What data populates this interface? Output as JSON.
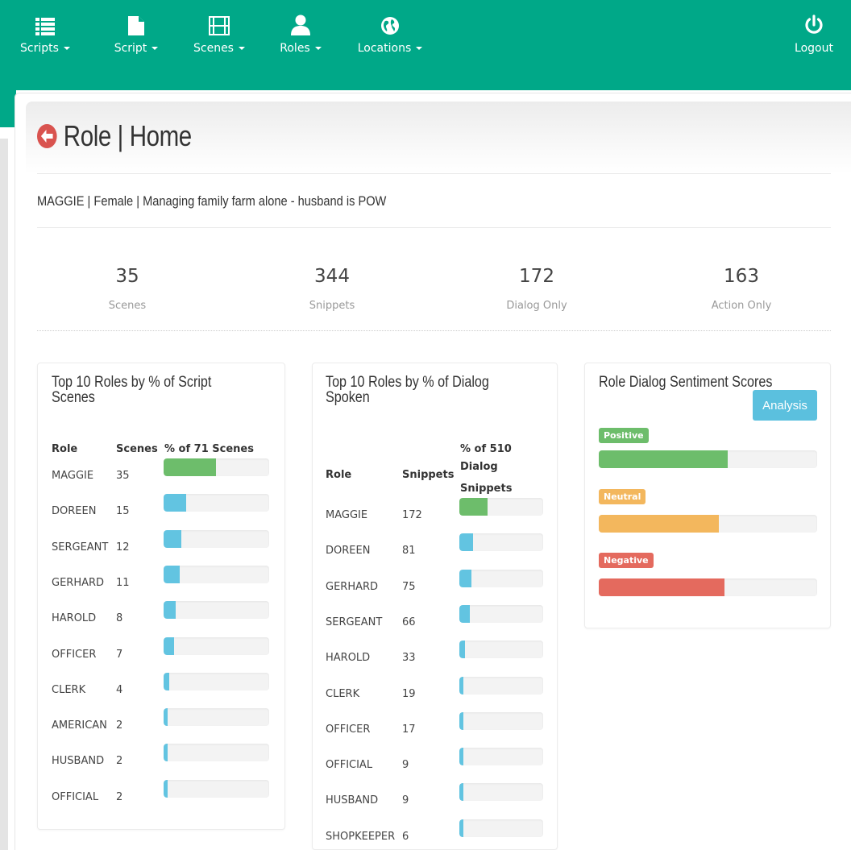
{
  "nav": {
    "items": [
      {
        "label": "Scripts",
        "icon": "list-icon"
      },
      {
        "label": "Script",
        "icon": "file-icon"
      },
      {
        "label": "Scenes",
        "icon": "film-icon"
      },
      {
        "label": "Roles",
        "icon": "user-icon"
      },
      {
        "label": "Locations",
        "icon": "globe-icon"
      }
    ],
    "logout": {
      "label": "Logout",
      "icon": "power-icon"
    }
  },
  "page": {
    "title": "Role | Home",
    "subtitle": "MAGGIE | Female | Managing family farm alone - husband is POW"
  },
  "stats": [
    {
      "value": "35",
      "label": "Scenes"
    },
    {
      "value": "344",
      "label": "Snippets"
    },
    {
      "value": "172",
      "label": "Dialog Only"
    },
    {
      "value": "163",
      "label": "Action Only"
    }
  ],
  "colors": {
    "accent": "#00a888",
    "green": "#6dbd6b",
    "blue": "#62c4e1",
    "orange": "#f3b75d",
    "red": "#e46a5e",
    "info_button": "#5bc0de"
  },
  "scenes_card": {
    "title_line1": "Top 10 Roles by % of Script",
    "title_line2": "Scenes",
    "header_role": "Role",
    "header_scenes": "Scenes",
    "header_pct": "% of 71 Scenes",
    "total": 71,
    "rows": [
      {
        "role": "MAGGIE",
        "count": "35",
        "value": 35
      },
      {
        "role": "DOREEN",
        "count": "15",
        "value": 15
      },
      {
        "role": "SERGEANT",
        "count": "12",
        "value": 12
      },
      {
        "role": "GERHARD",
        "count": "11",
        "value": 11
      },
      {
        "role": "HAROLD",
        "count": "8",
        "value": 8
      },
      {
        "role": "OFFICER",
        "count": "7",
        "value": 7
      },
      {
        "role": "CLERK",
        "count": "4",
        "value": 4
      },
      {
        "role": "AMERICAN",
        "count": "2",
        "value": 2
      },
      {
        "role": "HUSBAND",
        "count": "2",
        "value": 2
      },
      {
        "role": "OFFICIAL",
        "count": "2",
        "value": 2
      }
    ]
  },
  "dialog_card": {
    "title_line1": "Top 10 Roles by % of Dialog",
    "title_line2": "Spoken",
    "header_role": "Role",
    "header_snippets": "Snippets",
    "header_pct_line1": "% of 510",
    "header_pct_line2": "Dialog",
    "header_pct_line3": "Snippets",
    "total": 510,
    "rows": [
      {
        "role": "MAGGIE",
        "count": "172",
        "value": 172
      },
      {
        "role": "DOREEN",
        "count": "81",
        "value": 81
      },
      {
        "role": "GERHARD",
        "count": "75",
        "value": 75
      },
      {
        "role": "SERGEANT",
        "count": "66",
        "value": 66
      },
      {
        "role": "HAROLD",
        "count": "33",
        "value": 33
      },
      {
        "role": "CLERK",
        "count": "19",
        "value": 19
      },
      {
        "role": "OFFICER",
        "count": "17",
        "value": 17
      },
      {
        "role": "OFFICIAL",
        "count": "9",
        "value": 9
      },
      {
        "role": "HUSBAND",
        "count": "9",
        "value": 9
      },
      {
        "role": "SHOPKEEPER",
        "count": "6",
        "value": 6
      }
    ]
  },
  "sentiment_card": {
    "title": "Role Dialog Sentiment Scores",
    "button": "Analysis",
    "items": [
      {
        "label": "Positive",
        "fraction": 0.59,
        "color": "#6dbd6b"
      },
      {
        "label": "Neutral",
        "fraction": 0.55,
        "color": "#f3b75d"
      },
      {
        "label": "Negative",
        "fraction": 0.575,
        "color": "#e46a5e"
      }
    ]
  }
}
